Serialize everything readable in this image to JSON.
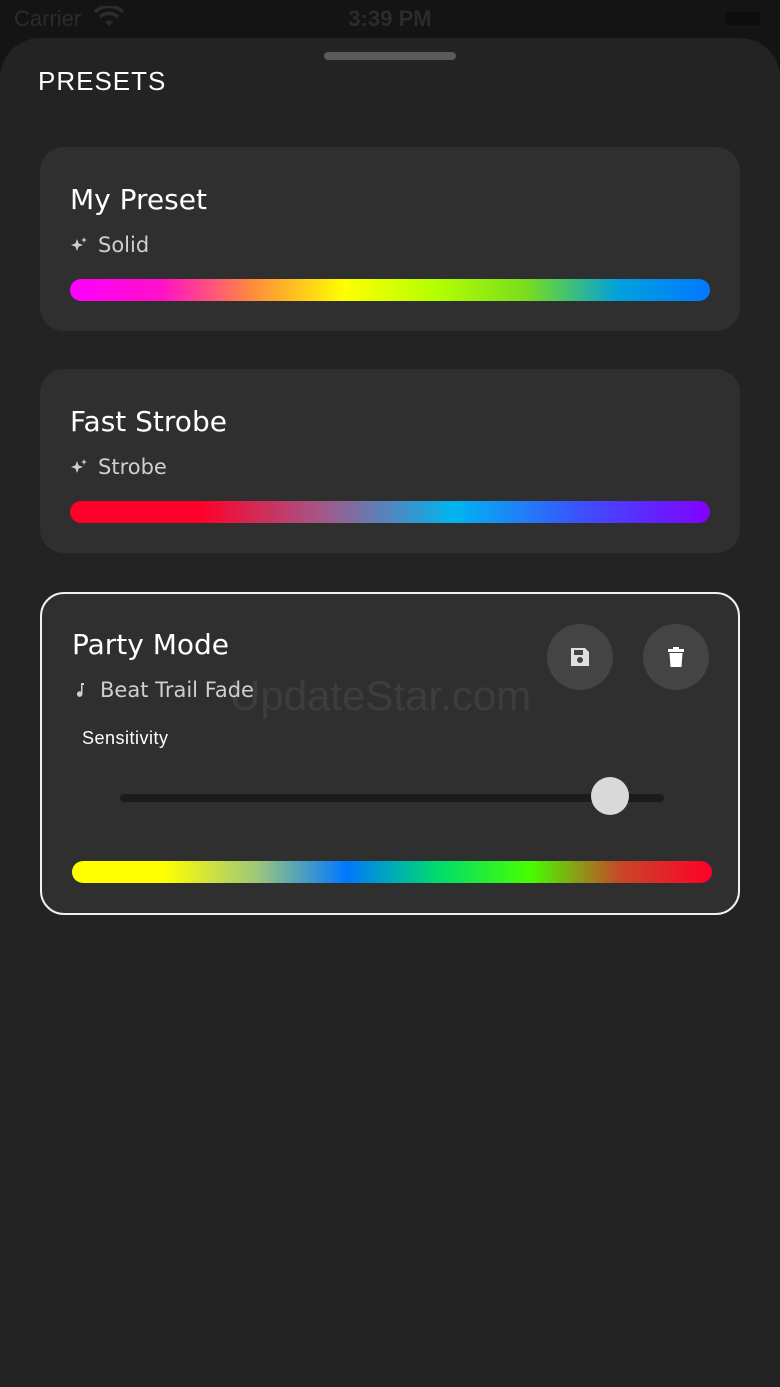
{
  "status_bar": {
    "carrier": "Carrier",
    "time": "3:39 PM"
  },
  "sheet": {
    "title": "PRESETS"
  },
  "presets": [
    {
      "name": "My Preset",
      "mode": "Solid",
      "mode_icon": "sparkles-icon",
      "gradient": [
        "#ff00ff",
        "#ff10c8",
        "#ff8c3c",
        "#ffff00",
        "#b4ff00",
        "#78dc1e",
        "#00a0dc",
        "#0078ff"
      ]
    },
    {
      "name": "Fast Strobe",
      "mode": "Strobe",
      "mode_icon": "sparkles-icon",
      "gradient": [
        "#ff0028",
        "#ff0028",
        "#a05a8c",
        "#00b4f0",
        "#3c50ff",
        "#8200ff"
      ]
    },
    {
      "name": "Party Mode",
      "mode": "Beat Trail Fade",
      "mode_icon": "music-note-icon",
      "selected": true,
      "actions": [
        "save-icon",
        "trash-icon"
      ],
      "slider": {
        "label": "Sensitivity",
        "value": 0.9
      },
      "gradient": [
        "#ffff00",
        "#ffff00",
        "#a0c878",
        "#0078ff",
        "#00dc6e",
        "#46ff00",
        "#c84628",
        "#ff0028"
      ]
    }
  ],
  "watermark": "UpdateStar.com"
}
